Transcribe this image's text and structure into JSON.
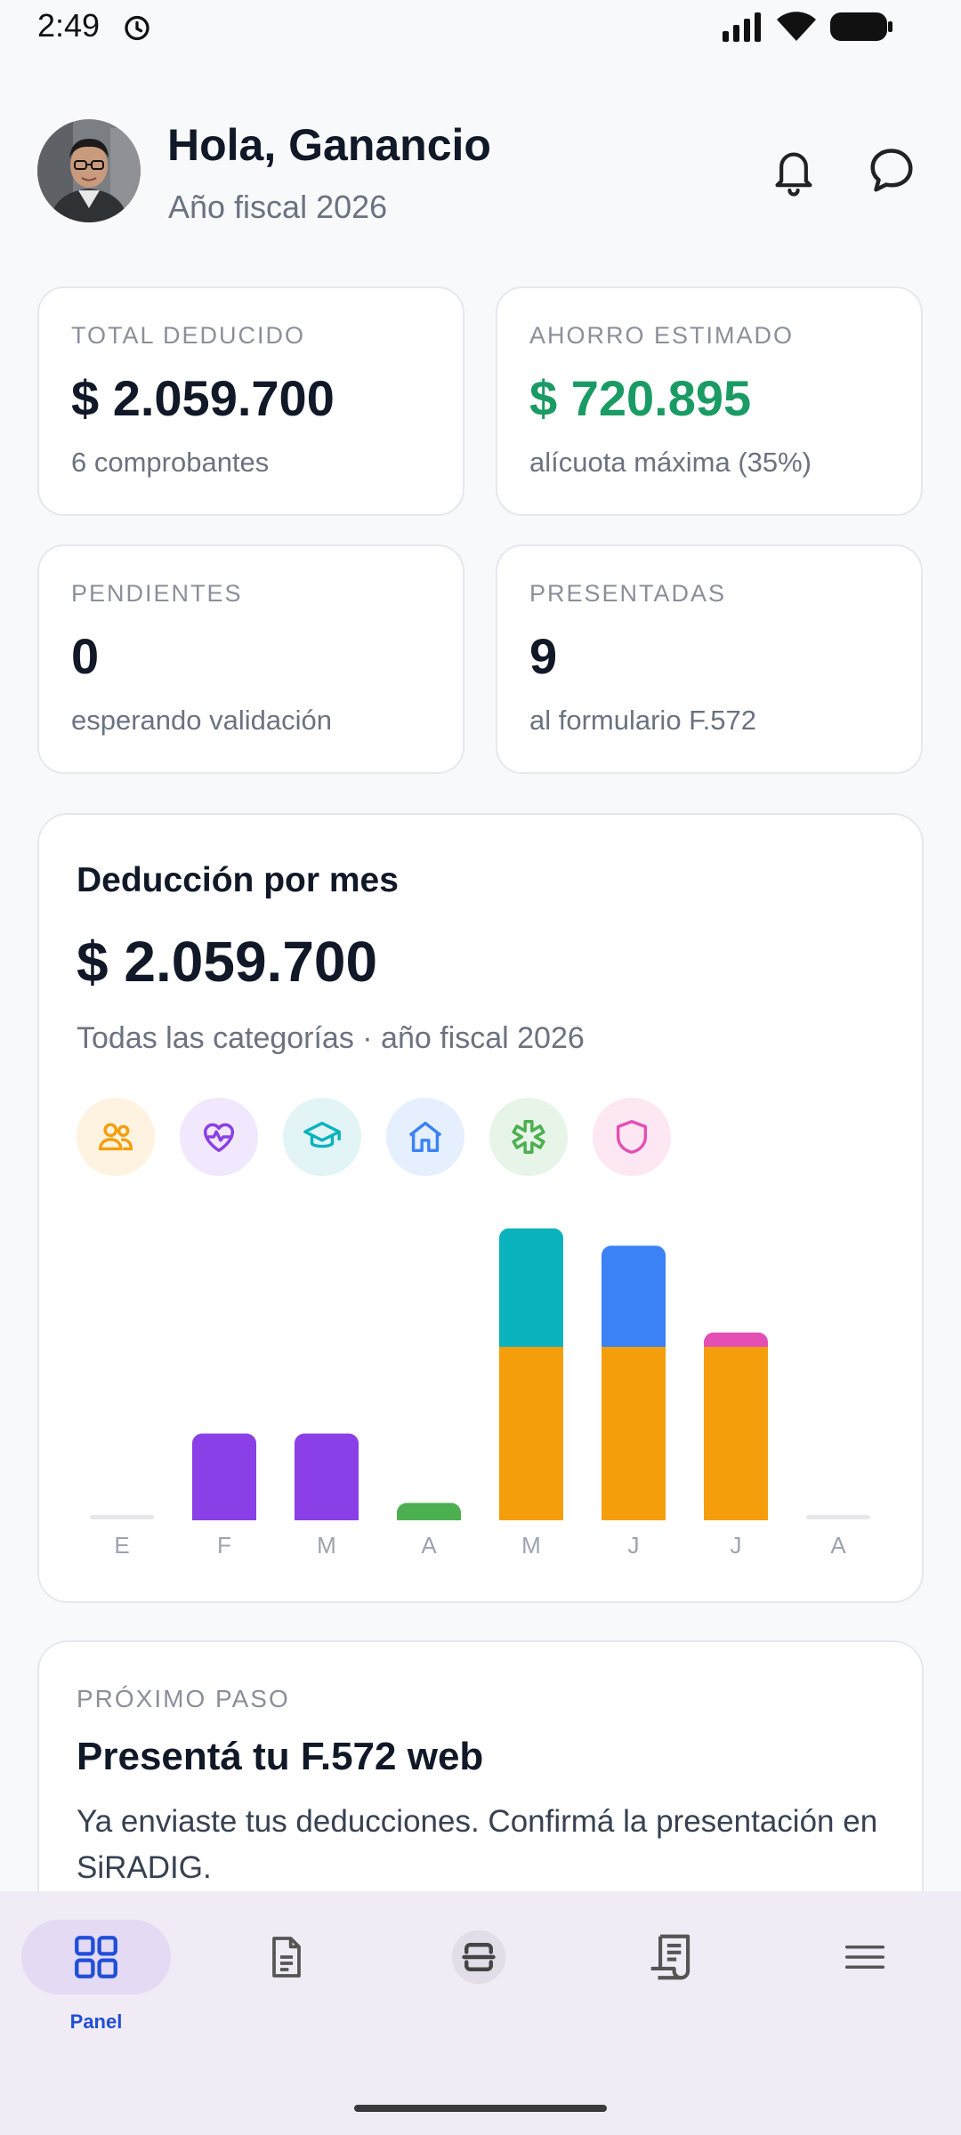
{
  "status_bar": {
    "time": "2:49"
  },
  "header": {
    "greeting": "Hola, Ganancio",
    "subtitle": "Año fiscal 2026"
  },
  "stats": [
    {
      "label": "TOTAL DEDUCIDO",
      "value": "$ 2.059.700",
      "note": "6 comprobantes"
    },
    {
      "label": "AHORRO ESTIMADO",
      "value": "$ 720.895",
      "note": "alícuota máxima (35%)",
      "value_color": "#1a9b64"
    },
    {
      "label": "PENDIENTES",
      "value": "0",
      "note": "esperando validación"
    },
    {
      "label": "PRESENTADAS",
      "value": "9",
      "note": "al formulario F.572"
    }
  ],
  "chart_card": {
    "title": "Deducción por mes",
    "total": "$ 2.059.700",
    "subtitle": "Todas las categorías · año fiscal 2026",
    "categories": [
      {
        "icon": "family-icon",
        "bg": "#fef3e0",
        "color": "#f59e0b"
      },
      {
        "icon": "health-heart-icon",
        "bg": "#f1e8fd",
        "color": "#8b3fe6"
      },
      {
        "icon": "education-cap-icon",
        "bg": "#e2f4f6",
        "color": "#0bb3be"
      },
      {
        "icon": "home-icon",
        "bg": "#e5effd",
        "color": "#3b82f6"
      },
      {
        "icon": "medical-asterisk-icon",
        "bg": "#e6f5e7",
        "color": "#4caf50"
      },
      {
        "icon": "insurance-shield-icon",
        "bg": "#fde7f3",
        "color": "#e44fb4"
      }
    ]
  },
  "chart_data": {
    "type": "bar",
    "stacked": true,
    "categories": [
      "E",
      "F",
      "M",
      "A",
      "M",
      "J",
      "J",
      "A"
    ],
    "series": [
      {
        "color": "#f59e0b",
        "values": [
          0,
          0,
          0,
          0,
          0.6,
          0.6,
          0.6,
          0
        ]
      },
      {
        "color": "#8b3fe6",
        "values": [
          0,
          0.3,
          0.3,
          0,
          0,
          0,
          0,
          0
        ]
      },
      {
        "color": "#0bb3be",
        "values": [
          0,
          0,
          0,
          0,
          0.41,
          0,
          0,
          0
        ]
      },
      {
        "color": "#3b82f6",
        "values": [
          0,
          0,
          0,
          0,
          0,
          0.35,
          0,
          0
        ]
      },
      {
        "color": "#4caf50",
        "values": [
          0,
          0,
          0,
          0.06,
          0,
          0,
          0,
          0
        ]
      },
      {
        "color": "#e44fb4",
        "values": [
          0,
          0,
          0,
          0,
          0,
          0,
          0.05,
          0
        ]
      }
    ],
    "ylim": [
      0,
      1
    ],
    "grid": false
  },
  "next_step": {
    "label": "PRÓXIMO PASO",
    "title": "Presentá tu F.572 web",
    "description": "Ya enviaste tus deducciones. Confirmá la presentación en SiRADIG."
  },
  "nav": {
    "items": [
      {
        "label": "Panel",
        "icon": "grid-icon",
        "active": true
      },
      {
        "label": "",
        "icon": "document-icon",
        "active": false
      },
      {
        "label": "",
        "icon": "scan-icon",
        "active": false
      },
      {
        "label": "",
        "icon": "receipt-icon",
        "active": false
      },
      {
        "label": "",
        "icon": "menu-icon",
        "active": false
      }
    ]
  }
}
